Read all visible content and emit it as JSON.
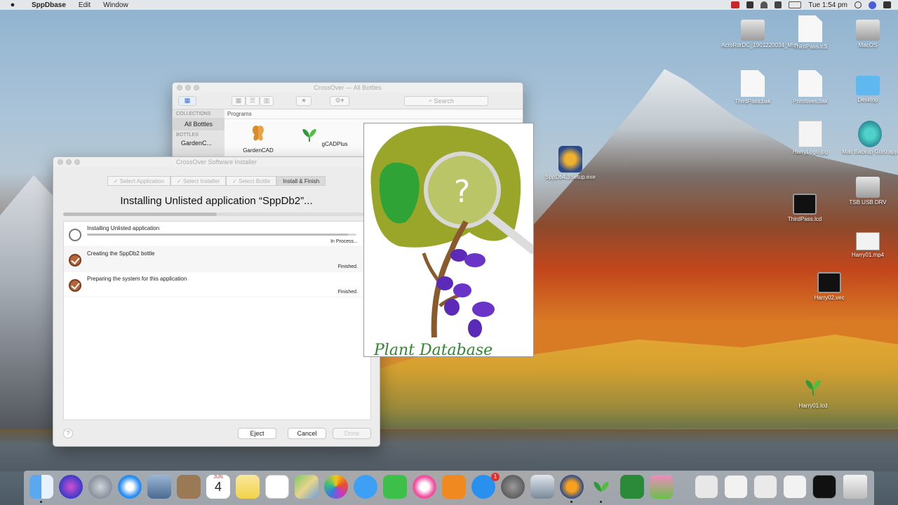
{
  "menubar": {
    "app_name": "SppDbase",
    "items": [
      "Edit",
      "Window"
    ],
    "time": "Tue 1:54 pm"
  },
  "bottles_window": {
    "title": "CrossOver — All Bottles",
    "search_placeholder": "Search",
    "collections_header": "COLLECTIONS",
    "all_bottles": "All Bottles",
    "bottles_header": "BOTTLES",
    "bottle_item": "GardenC...",
    "programs_header": "Programs",
    "programs": [
      "GardenCAD",
      "gCADPlus"
    ]
  },
  "installer": {
    "title": "CrossOver Software Installer",
    "steps": [
      "Select Application",
      "Select Installer",
      "Select Bottle",
      "Install & Finish"
    ],
    "heading": "Installing Unlisted application “SppDb2”...",
    "overall_progress": 0.5,
    "tasks": [
      {
        "label": "Installing Unlisted application",
        "state": "In Process...",
        "progress": 0.97
      },
      {
        "label": "Creating the SppDb2 bottle",
        "state": "Finished."
      },
      {
        "label": "Preparing the system for this application",
        "state": "Finished."
      }
    ],
    "buttons": {
      "eject": "Eject",
      "cancel": "Cancel",
      "done": "Done"
    },
    "help": "?"
  },
  "plant_image": {
    "caption": "Plant Database",
    "question_mark": "?"
  },
  "desktop_icons": [
    {
      "label": "AcroRdrDC_1901220034_MUI",
      "type": "drive"
    },
    {
      "label": "ThirdPass.lc$",
      "type": "doc"
    },
    {
      "label": "MacOS",
      "type": "drive"
    },
    {
      "label": "ThirdPass.bak",
      "type": "doc"
    },
    {
      "label": "Primitives.bak",
      "type": "doc"
    },
    {
      "label": "Desktop",
      "type": "folder"
    },
    {
      "label": "HarryLogo.jpg",
      "type": "image"
    },
    {
      "label": "Mac Backup Guru.app",
      "type": "app"
    },
    {
      "label": "SppDb4.3Setup.exe",
      "type": "exe"
    },
    {
      "label": "ThirdPass.lcd",
      "type": "term"
    },
    {
      "label": "TSB USB DRV",
      "type": "drive"
    },
    {
      "label": "Harry01.mp4",
      "type": "video"
    },
    {
      "label": "Harry02.vec",
      "type": "term"
    },
    {
      "label": "Harry01.lcd",
      "type": "plant"
    }
  ],
  "dock": {
    "calendar_month": "JUN",
    "calendar_day": "4",
    "appstore_badge": "1"
  }
}
